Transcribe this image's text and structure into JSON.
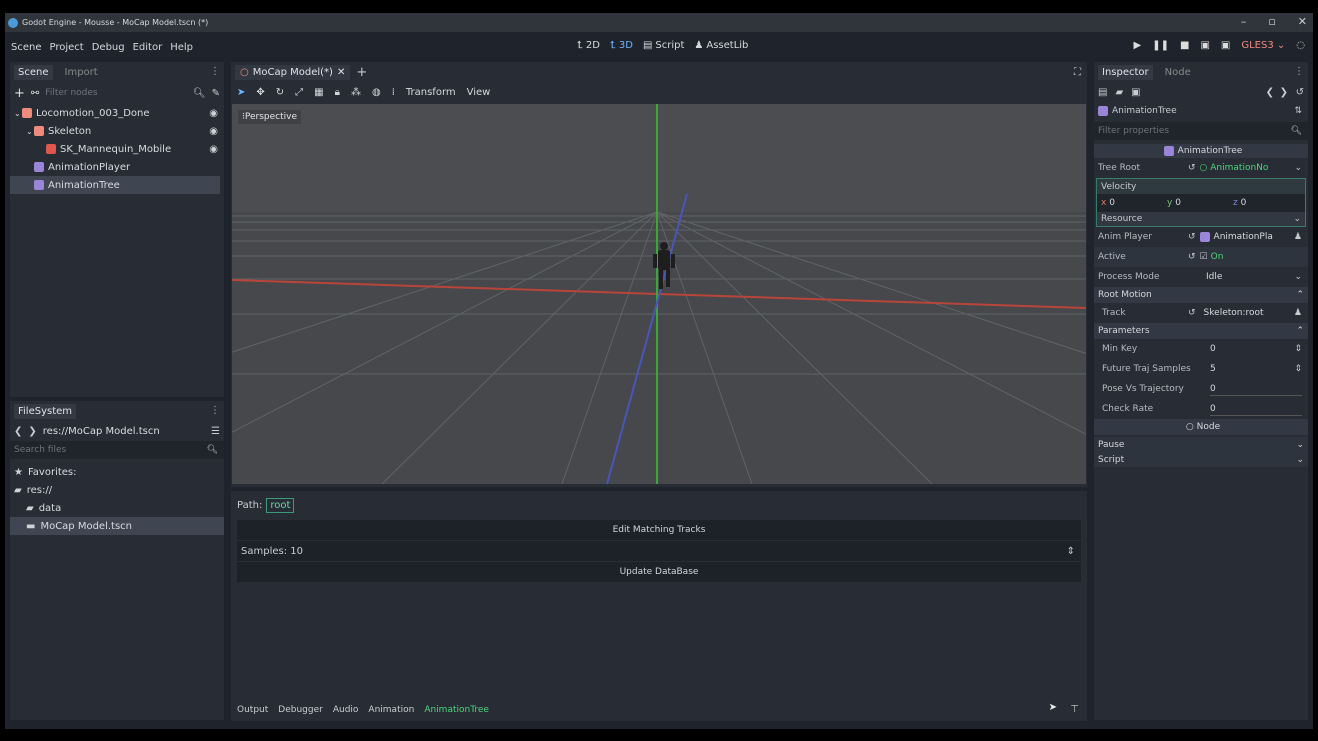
{
  "titlebar": {
    "title": "Godot Engine - Mousse - MoCap Model.tscn (*)",
    "controls": [
      "–",
      "▫",
      "✕"
    ]
  },
  "menu": {
    "items": [
      "Scene",
      "Project",
      "Debug",
      "Editor",
      "Help"
    ]
  },
  "modes": {
    "items": [
      {
        "label": "2D",
        "active": false
      },
      {
        "label": "3D",
        "active": true
      },
      {
        "label": "Script",
        "active": false
      },
      {
        "label": "AssetLib",
        "active": false
      }
    ]
  },
  "playbar": {
    "renderer": "GLES3"
  },
  "scene_dock": {
    "tabs": [
      "Scene",
      "Import"
    ],
    "filter_placeholder": "Filter nodes",
    "nodes": [
      {
        "label": "Locomotion_003_Done",
        "icon": "node3d-icon",
        "indent": 0,
        "eye": true,
        "selected": false
      },
      {
        "label": "Skeleton",
        "icon": "skeleton-icon",
        "indent": 1,
        "eye": true,
        "selected": false
      },
      {
        "label": "SK_Mannequin_Mobile",
        "icon": "mesh-icon",
        "indent": 2,
        "eye": true,
        "selected": false
      },
      {
        "label": "AnimationPlayer",
        "icon": "animation-player-icon",
        "indent": 1,
        "eye": false,
        "selected": false
      },
      {
        "label": "AnimationTree",
        "icon": "animation-tree-icon",
        "indent": 1,
        "eye": false,
        "selected": true
      }
    ]
  },
  "filesystem": {
    "tab": "FileSystem",
    "path": "res://MoCap Model.tscn",
    "search_placeholder": "Search files",
    "items": [
      {
        "label": "Favorites:",
        "indent": 0,
        "icon": "star-icon",
        "selected": false
      },
      {
        "label": "res://",
        "indent": 0,
        "icon": "folder-icon",
        "selected": false
      },
      {
        "label": "data",
        "indent": 1,
        "icon": "folder-icon",
        "selected": false
      },
      {
        "label": "MoCap Model.tscn",
        "indent": 1,
        "icon": "scene-file-icon",
        "selected": true
      }
    ]
  },
  "editor": {
    "tab_label": "MoCap Model(*)",
    "toolbar": {
      "transform": "Transform",
      "view": "View"
    },
    "viewport_label": "Perspective"
  },
  "bottom": {
    "path_label": "Path:",
    "path_value": "root",
    "edit_button": "Edit Matching Tracks",
    "samples": "Samples: 10",
    "update_button": "Update DataBase",
    "tabs": [
      {
        "label": "Output",
        "active": false
      },
      {
        "label": "Debugger",
        "active": false
      },
      {
        "label": "Audio",
        "active": false
      },
      {
        "label": "Animation",
        "active": false
      },
      {
        "label": "AnimationTree",
        "active": true
      }
    ]
  },
  "inspector": {
    "tabs": [
      "Inspector",
      "Node"
    ],
    "object": "AnimationTree",
    "filter_placeholder": "Filter properties",
    "header": "AnimationTree",
    "tree_root": {
      "label": "Tree Root",
      "value": "AnimationNo"
    },
    "velocity": {
      "label": "Velocity",
      "x": "0",
      "y": "0",
      "z": "0",
      "resource": "Resource"
    },
    "anim_player": {
      "label": "Anim Player",
      "value": "AnimationPla"
    },
    "active": {
      "label": "Active",
      "value": "On"
    },
    "process_mode": {
      "label": "Process Mode",
      "value": "Idle"
    },
    "root_motion": {
      "section": "Root Motion",
      "track_label": "Track",
      "track_value": "Skeleton:root"
    },
    "parameters": {
      "section": "Parameters",
      "rows": [
        {
          "label": "Min Key",
          "value": "0"
        },
        {
          "label": "Future Traj Samples",
          "value": "5"
        },
        {
          "label": "Pose Vs Trajectory",
          "value": "0"
        },
        {
          "label": "Check Rate",
          "value": "0"
        }
      ]
    },
    "node_header": "Node",
    "pause": "Pause",
    "script": "Script"
  }
}
